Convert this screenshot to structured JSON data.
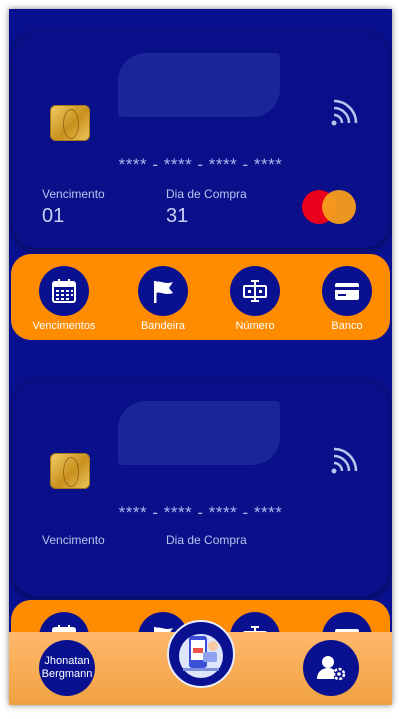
{
  "cards": [
    {
      "number": "**** - **** - **** - ****",
      "due_label": "Vencimento",
      "due_value": "01",
      "purchase_label": "Dia de Compra",
      "purchase_value": "31",
      "brand_icon": "mastercard-logo"
    },
    {
      "number": "**** - **** - **** - ****",
      "due_label": "Vencimento",
      "due_value": "",
      "purchase_label": "Dia de Compra",
      "purchase_value": ""
    }
  ],
  "actions": [
    {
      "label": "Vencimentos",
      "icon": "calendar-icon"
    },
    {
      "label": "Bandeira",
      "icon": "flag-icon"
    },
    {
      "label": "Número",
      "icon": "text-cursor-icon"
    },
    {
      "label": "Banco",
      "icon": "credit-card-icon"
    }
  ],
  "bottom_bar": {
    "user_name": "Jhonatan Bergmann",
    "center_icon": "credit-cards-illustration-icon",
    "settings_icon": "user-settings-icon"
  },
  "colors": {
    "background": "#0a1190",
    "card": "#0a0f8a",
    "accent": "#ff8c00",
    "text_light": "#b8c4ee",
    "mastercard_red": "#eb001b",
    "mastercard_orange": "#f79e1b"
  }
}
